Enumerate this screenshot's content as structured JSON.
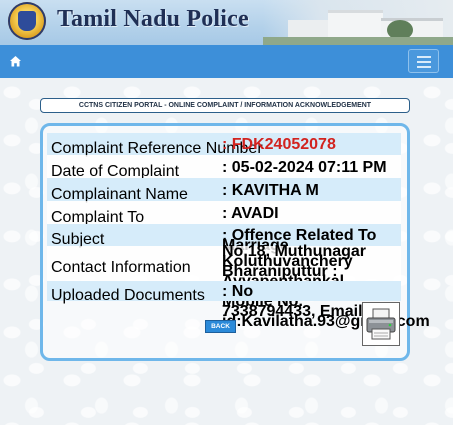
{
  "header": {
    "title": "Tamil Nadu Police"
  },
  "navbar": {
    "home_icon": "home-icon",
    "menu_icon": "hamburger-menu-icon"
  },
  "acknowledgement": {
    "title": "CCTNS CITIZEN PORTAL - ONLINE COMPLAINT / INFORMATION ACKNOWLEDGEMENT",
    "rows": [
      {
        "label": "Complaint Reference Number",
        "value": ": FDK24052078"
      },
      {
        "label": "Date of Complaint",
        "value": ": 05-02-2024 07:11 PM"
      },
      {
        "label": "Complainant Name",
        "value": ": KAVITHA M"
      },
      {
        "label": "Complaint To",
        "value": ": AVADI"
      },
      {
        "label": "Subject",
        "value": ": Offence Related To Marriage"
      },
      {
        "label": "Contact Information",
        "value": "No.18, Muthunagar Koluthuvanchery Bharaniputtur : Ayyapenthankal Chennai 600122, Mobile No. 7338794433, Email-id:Kavilatha.93@gmail.com"
      },
      {
        "label": "Uploaded Documents",
        "value": ": No"
      }
    ],
    "back_label": "BACK",
    "print_icon": "printer-icon"
  },
  "colors": {
    "nav": "#3d8fd9",
    "accent_red": "#d2231f",
    "frame": "#6fb7ea"
  }
}
